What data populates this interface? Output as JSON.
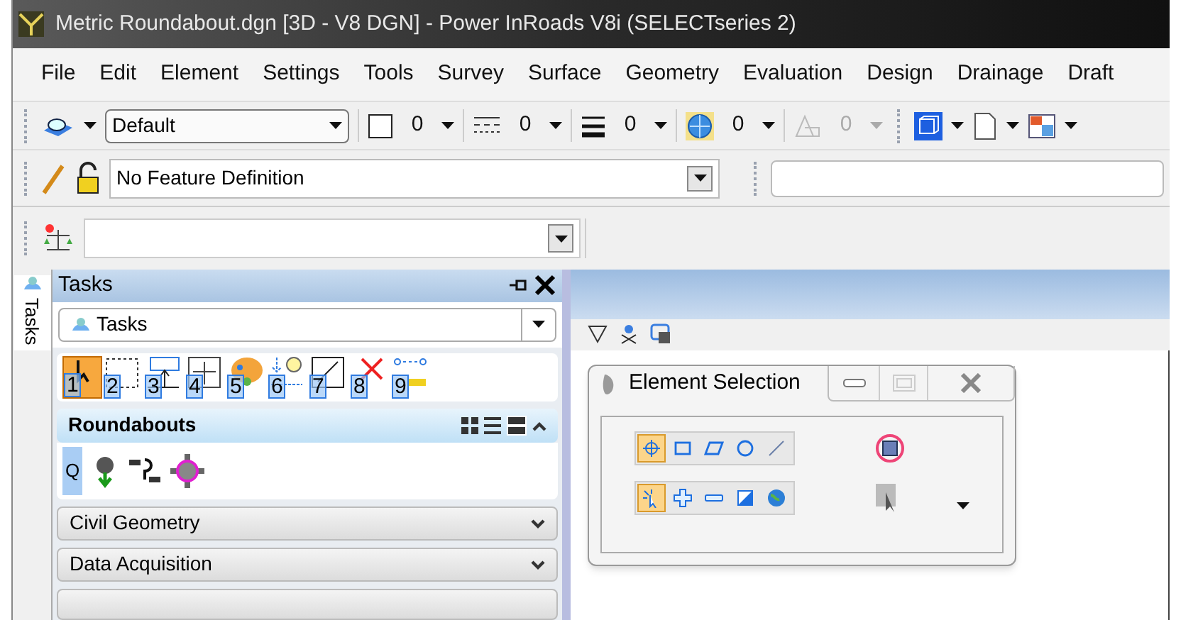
{
  "window": {
    "title": "Metric Roundabout.dgn [3D - V8 DGN] - Power InRoads V8i (SELECTseries 2)"
  },
  "menu": [
    "File",
    "Edit",
    "Element",
    "Settings",
    "Tools",
    "Survey",
    "Surface",
    "Geometry",
    "Evaluation",
    "Design",
    "Drainage",
    "Draft"
  ],
  "attributes_toolbar": {
    "level": "Default",
    "values": [
      {
        "value": "0",
        "disabled": false
      },
      {
        "value": "0",
        "disabled": false
      },
      {
        "value": "0",
        "disabled": false
      },
      {
        "value": "0",
        "disabled": false
      },
      {
        "value": "0",
        "disabled": true
      }
    ]
  },
  "feature_toolbar": {
    "feature": "No Feature Definition"
  },
  "tasks_panel": {
    "tab": "Tasks",
    "title": "Tasks",
    "combo": "Tasks",
    "steps": [
      {
        "label": "1",
        "selected": true
      },
      {
        "label": "2",
        "selected": false
      },
      {
        "label": "3",
        "selected": false
      },
      {
        "label": "4",
        "selected": false
      },
      {
        "label": "5",
        "selected": false
      },
      {
        "label": "6",
        "selected": false
      },
      {
        "label": "7",
        "selected": false
      },
      {
        "label": "8",
        "selected": false
      },
      {
        "label": "9",
        "selected": false
      }
    ],
    "groups": [
      {
        "title": "Roundabouts",
        "expanded": true,
        "tool_label": "Q"
      },
      {
        "title": "Civil Geometry",
        "expanded": false
      },
      {
        "title": "Data Acquisition",
        "expanded": false
      }
    ]
  },
  "element_selection": {
    "title": "Element Selection",
    "methods": [
      {
        "selected": true
      },
      {
        "selected": false
      },
      {
        "selected": false
      },
      {
        "selected": false
      },
      {
        "selected": false
      }
    ],
    "modes": [
      {
        "selected": true
      },
      {
        "selected": false
      },
      {
        "selected": false
      },
      {
        "selected": false
      },
      {
        "selected": false
      }
    ]
  }
}
